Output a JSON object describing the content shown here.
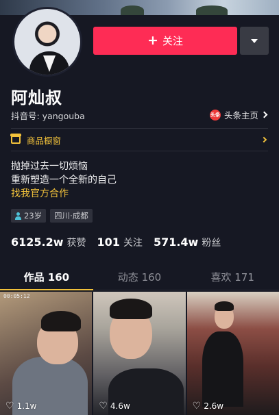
{
  "profile": {
    "name": "阿灿叔",
    "douyin_id": "抖音号: yangouba",
    "follow_label": "关注",
    "follow_icon": "plus-icon",
    "more_icon": "dropdown-triangle-icon",
    "toutiao_icon_text": "头条",
    "toutiao_label": "头条主页"
  },
  "shop": {
    "label": "商品橱窗",
    "icon": "shop-window-icon"
  },
  "bio": {
    "line1": "抛掉过去一切烦恼",
    "line2": "重新塑造一个全新的自己",
    "link": "找我官方合作"
  },
  "tags": {
    "age": "23岁",
    "location": "四川·成都"
  },
  "stats": {
    "likes_value": "6125.2w",
    "likes_label": "获赞",
    "following_value": "101",
    "following_label": "关注",
    "followers_value": "571.4w",
    "followers_label": "粉丝"
  },
  "tabs": [
    {
      "label": "作品 160",
      "active": true
    },
    {
      "label": "动态 160",
      "active": false
    },
    {
      "label": "喜欢 171",
      "active": false
    }
  ],
  "videos": [
    {
      "likes": "1.1w",
      "timestamp": "00:05:12"
    },
    {
      "likes": "4.6w"
    },
    {
      "likes": "2.6w"
    }
  ],
  "colors": {
    "background": "#161823",
    "follow_button": "#fe2c55",
    "accent_yellow": "#f2c23b",
    "toutiao_red": "#ed3a3a"
  }
}
